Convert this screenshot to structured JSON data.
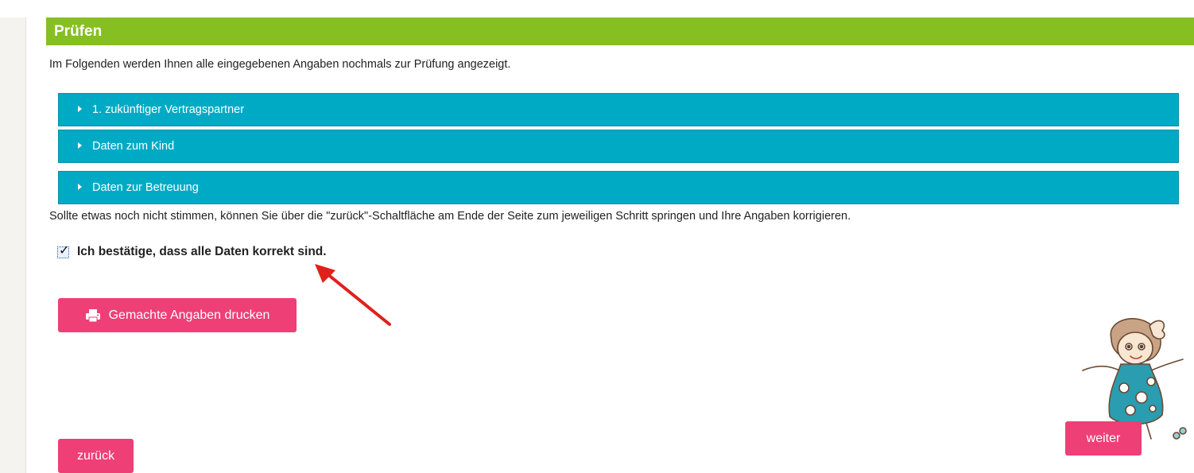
{
  "header": {
    "title": "Prüfen"
  },
  "intro_text": "Im Folgenden werden Ihnen alle eingegebenen Angaben nochmals zur Prüfung angezeigt.",
  "accordions": [
    {
      "label": "1. zukünftiger Vertragspartner"
    },
    {
      "label": "Daten zum Kind"
    },
    {
      "label": "Daten zur Betreuung"
    }
  ],
  "hint_text": "Sollte etwas noch nicht stimmen, können Sie über die \"zurück\"-Schaltfläche am Ende der Seite zum jeweiligen Schritt springen und Ihre Angaben korrigieren.",
  "confirm": {
    "label": "Ich bestätige, dass alle Daten korrekt sind.",
    "checked": true
  },
  "print_button": {
    "label": "Gemachte Angaben drucken",
    "icon": "printer-icon"
  },
  "nav": {
    "back_label": "zurück",
    "next_label": "weiter"
  },
  "colors": {
    "header_green": "#86bf22",
    "accordion_teal": "#00aac5",
    "button_pink": "#ee3f76",
    "annotation_arrow": "#e0201b"
  }
}
